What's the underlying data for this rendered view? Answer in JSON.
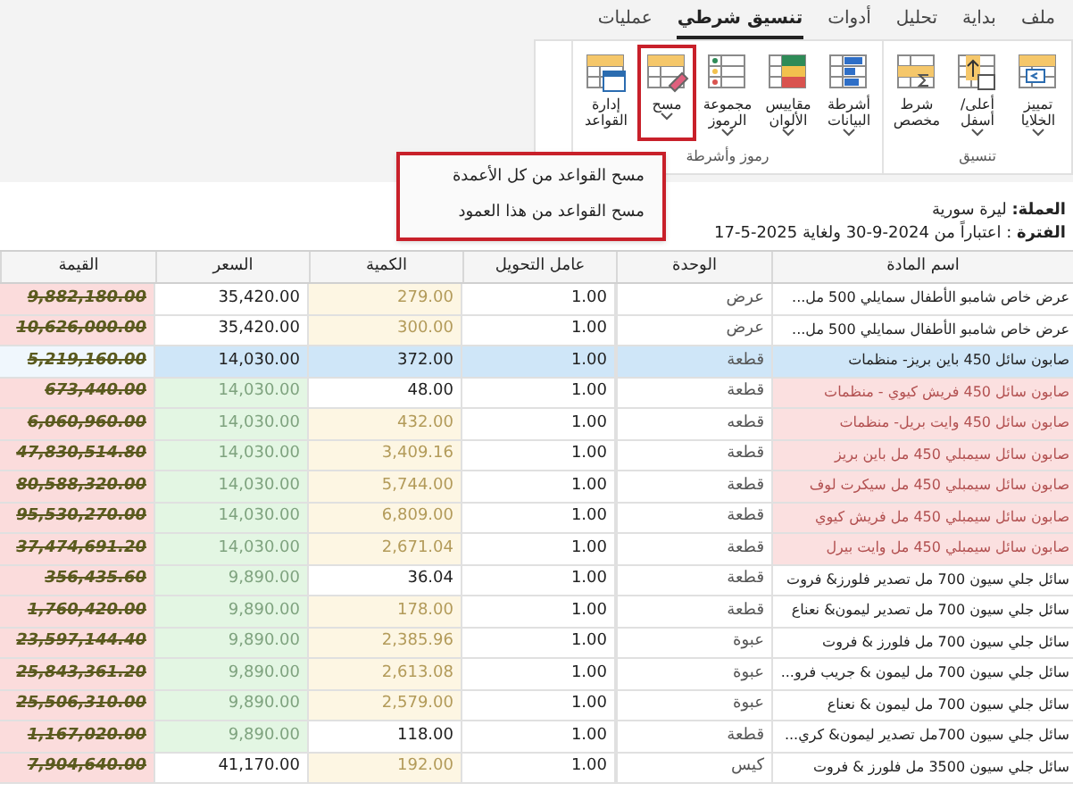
{
  "menu_tabs": [
    {
      "label": "ملف",
      "selected": false
    },
    {
      "label": "بداية",
      "selected": false
    },
    {
      "label": "تحليل",
      "selected": false
    },
    {
      "label": "أدوات",
      "selected": false
    },
    {
      "label": "تنسيق شرطي",
      "selected": true
    },
    {
      "label": "عمليات",
      "selected": false
    }
  ],
  "ribbon_groups": [
    {
      "label": "تنسيق",
      "buttons": [
        {
          "kind": "highlight",
          "label": "تمييز الخلايا",
          "has_menu": true,
          "highlighted": false
        },
        {
          "kind": "topbottom",
          "label": "أعلى/أسفل",
          "has_menu": true,
          "highlighted": false
        },
        {
          "kind": "custom",
          "label": "شرط مخصص",
          "has_menu": false,
          "highlighted": false
        }
      ]
    },
    {
      "label": "رموز وأشرطة",
      "buttons": [
        {
          "kind": "databars",
          "label": "أشرطة البيانات",
          "has_menu": true,
          "highlighted": false
        },
        {
          "kind": "colorscales",
          "label": "مقاييس الألوان",
          "has_menu": true,
          "highlighted": false
        },
        {
          "kind": "iconsets",
          "label": "مجموعة الرموز",
          "has_menu": true,
          "highlighted": false
        },
        {
          "kind": "clear",
          "label": "مسح",
          "has_menu": true,
          "highlighted": true
        },
        {
          "kind": "manage",
          "label": "إدارة القواعد",
          "has_menu": false,
          "highlighted": false
        }
      ]
    }
  ],
  "clear_menu": {
    "items": [
      "مسح القواعد من كل الأعمدة",
      "مسح القواعد من هذا العمود"
    ]
  },
  "info": {
    "currency": "**العملة:** ليرة سورية",
    "period": "**الفترة** : اعتباراً من 2024-9-30 ولغاية 2025-5-17"
  },
  "table": {
    "columns": [
      "اسم المادة",
      "الوحدة",
      "عامل التحويل",
      "الكمية",
      "السعر",
      "القيمة"
    ],
    "rows": [
      {
        "name": "عرض خاص شامبو الأطفال سمايلي 500 مل...",
        "unit": "عرض",
        "factor": "1.00",
        "qty": "279.00",
        "price": "35,420.00",
        "value": "9,882,180.00",
        "selected": false,
        "name_flag": false,
        "qty_flag": true,
        "price_flag": false
      },
      {
        "name": "عرض خاص شامبو الأطفال سمايلي 500 مل...",
        "unit": "عرض",
        "factor": "1.00",
        "qty": "300.00",
        "price": "35,420.00",
        "value": "10,626,000.00",
        "selected": false,
        "name_flag": false,
        "qty_flag": true,
        "price_flag": false
      },
      {
        "name": "صابون سائل 450 باين بريز- منظمات",
        "unit": "قطعة",
        "factor": "1.00",
        "qty": "372.00",
        "price": "14,030.00",
        "value": "5,219,160.00",
        "selected": true,
        "name_flag": false,
        "qty_flag": false,
        "price_flag": false
      },
      {
        "name": "صابون سائل 450 فريش كيوي - منظمات",
        "unit": "قطعة",
        "factor": "1.00",
        "qty": "48.00",
        "price": "14,030.00",
        "value": "673,440.00",
        "selected": false,
        "name_flag": true,
        "qty_flag": false,
        "price_flag": true
      },
      {
        "name": "صابون سائل 450 وايت بريل- منظمات",
        "unit": "قطعه",
        "factor": "1.00",
        "qty": "432.00",
        "price": "14,030.00",
        "value": "6,060,960.00",
        "selected": false,
        "name_flag": true,
        "qty_flag": true,
        "price_flag": true
      },
      {
        "name": "صابون سائل سيمبلي 450 مل باين بريز",
        "unit": "قطعة",
        "factor": "1.00",
        "qty": "3,409.16",
        "price": "14,030.00",
        "value": "47,830,514.80",
        "selected": false,
        "name_flag": true,
        "qty_flag": true,
        "price_flag": true
      },
      {
        "name": "صابون سائل سيمبلي 450 مل سيكرت لوف",
        "unit": "قطعة",
        "factor": "1.00",
        "qty": "5,744.00",
        "price": "14,030.00",
        "value": "80,588,320.00",
        "selected": false,
        "name_flag": true,
        "qty_flag": true,
        "price_flag": true
      },
      {
        "name": "صابون سائل سيمبلي 450 مل فريش كيوي",
        "unit": "قطعة",
        "factor": "1.00",
        "qty": "6,809.00",
        "price": "14,030.00",
        "value": "95,530,270.00",
        "selected": false,
        "name_flag": true,
        "qty_flag": true,
        "price_flag": true
      },
      {
        "name": "صابون سائل سيمبلي 450 مل وايت بيرل",
        "unit": "قطعة",
        "factor": "1.00",
        "qty": "2,671.04",
        "price": "14,030.00",
        "value": "37,474,691.20",
        "selected": false,
        "name_flag": true,
        "qty_flag": true,
        "price_flag": true
      },
      {
        "name": "سائل جلي سيون 700 مل تصدير فلورز& فروت",
        "unit": "قطعة",
        "factor": "1.00",
        "qty": "36.04",
        "price": "9,890.00",
        "value": "356,435.60",
        "selected": false,
        "name_flag": false,
        "qty_flag": false,
        "price_flag": true
      },
      {
        "name": "سائل جلي سيون 700 مل تصدير ليمون& نعناع",
        "unit": "قطعة",
        "factor": "1.00",
        "qty": "178.00",
        "price": "9,890.00",
        "value": "1,760,420.00",
        "selected": false,
        "name_flag": false,
        "qty_flag": true,
        "price_flag": true
      },
      {
        "name": "سائل جلي سيون 700 مل فلورز & فروت",
        "unit": "عبوة",
        "factor": "1.00",
        "qty": "2,385.96",
        "price": "9,890.00",
        "value": "23,597,144.40",
        "selected": false,
        "name_flag": false,
        "qty_flag": true,
        "price_flag": true
      },
      {
        "name": "سائل جلي سيون 700 مل ليمون & جريب فرو...",
        "unit": "عبوة",
        "factor": "1.00",
        "qty": "2,613.08",
        "price": "9,890.00",
        "value": "25,843,361.20",
        "selected": false,
        "name_flag": false,
        "qty_flag": true,
        "price_flag": true
      },
      {
        "name": "سائل جلي سيون 700 مل ليمون & نعناع",
        "unit": "عبوة",
        "factor": "1.00",
        "qty": "2,579.00",
        "price": "9,890.00",
        "value": "25,506,310.00",
        "selected": false,
        "name_flag": false,
        "qty_flag": true,
        "price_flag": true
      },
      {
        "name": "سائل جلي سيون 700مل تصدير ليمون& كري...",
        "unit": "قطعة",
        "factor": "1.00",
        "qty": "118.00",
        "price": "9,890.00",
        "value": "1,167,020.00",
        "selected": false,
        "name_flag": false,
        "qty_flag": false,
        "price_flag": true
      },
      {
        "name": "سائل جلي سيون 3500 مل فلورز & فروت",
        "unit": "كيس",
        "factor": "1.00",
        "qty": "192.00",
        "price": "41,170.00",
        "value": "7,904,640.00",
        "selected": false,
        "name_flag": false,
        "qty_flag": true,
        "price_flag": false
      }
    ]
  }
}
